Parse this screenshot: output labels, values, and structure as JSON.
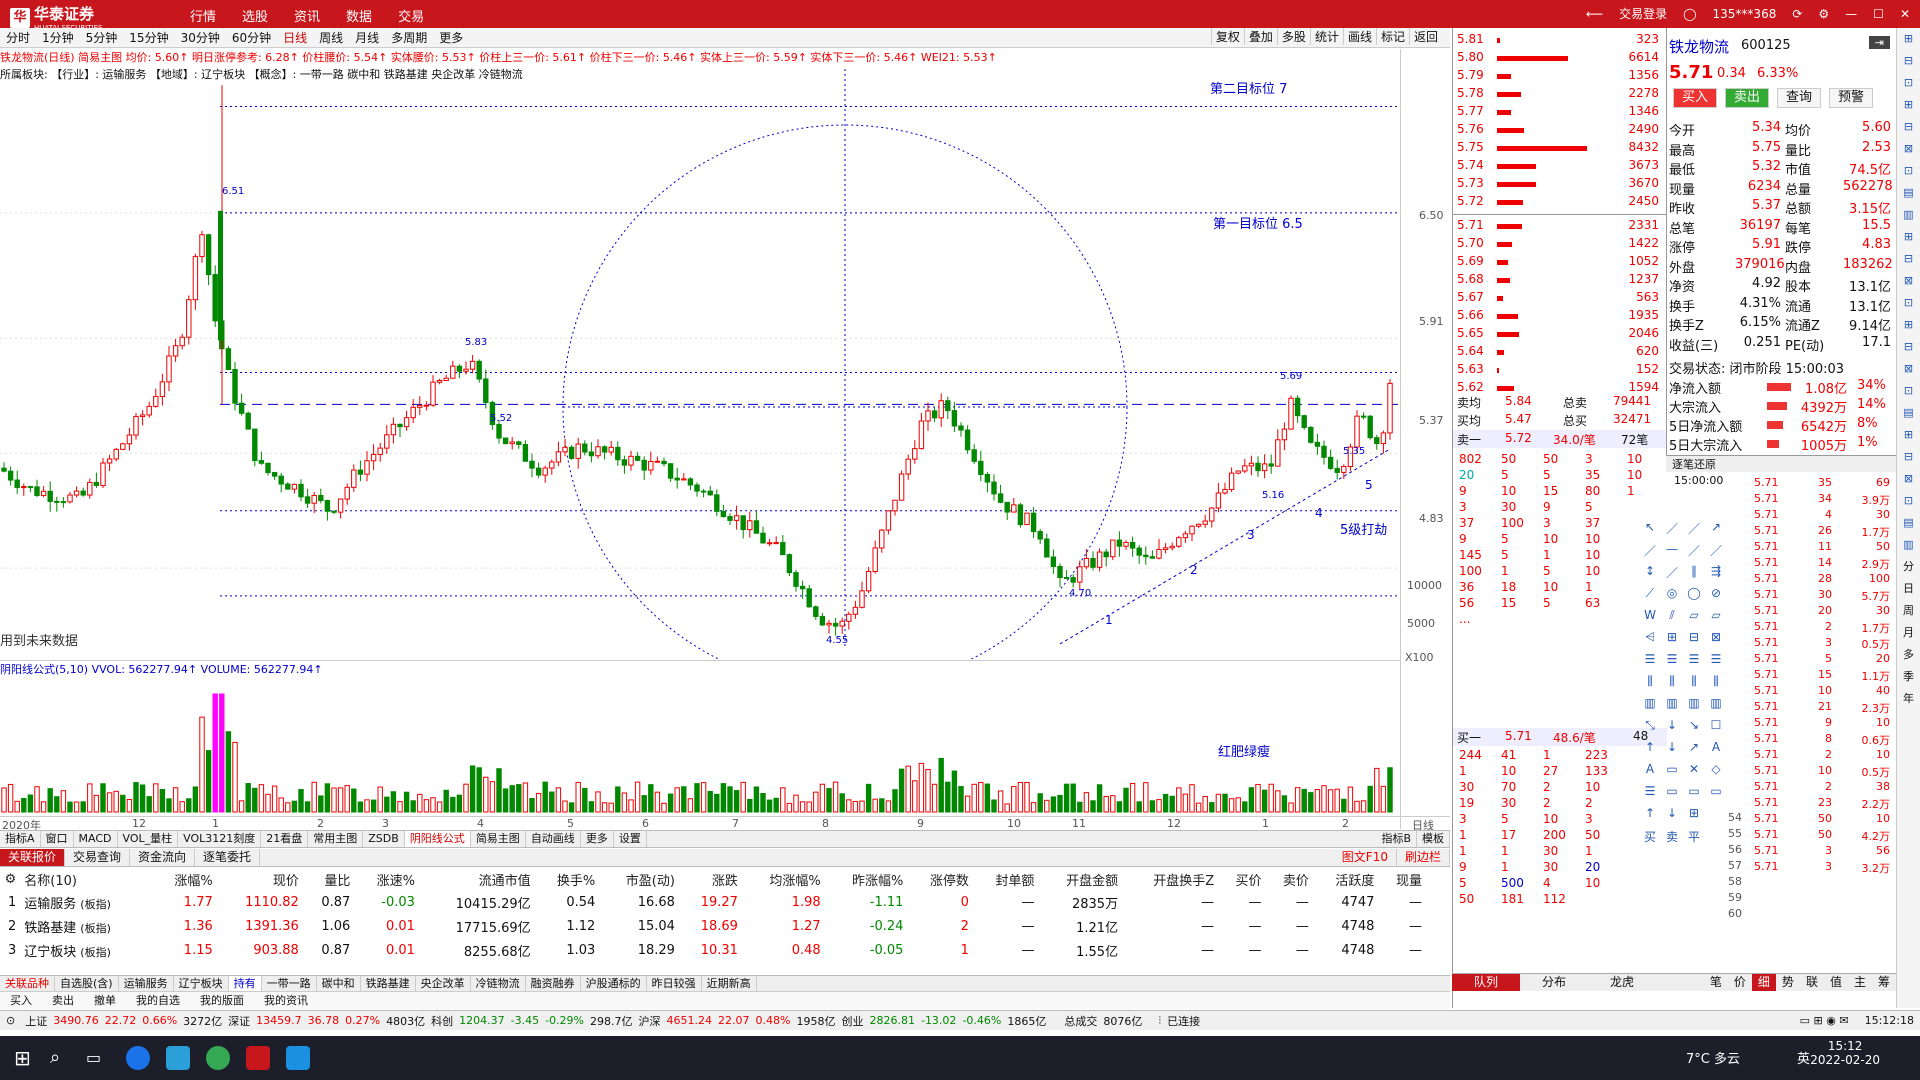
{
  "app": {
    "brand": "华泰证券",
    "brand_en": "HUATAI SECURITIES",
    "menu": [
      "行情",
      "选股",
      "资讯",
      "数据",
      "交易"
    ],
    "login": "交易登录",
    "user": "135***368"
  },
  "periods": [
    "分时",
    "1分钟",
    "5分钟",
    "15分钟",
    "30分钟",
    "60分钟",
    "日线",
    "周线",
    "月线",
    "多周期",
    "更多"
  ],
  "active_period": "日线",
  "chart_tools": [
    "复权",
    "叠加",
    "多股",
    "统计",
    "画线",
    "标记",
    "返回"
  ],
  "main_info": "铁龙物流(日线) 简易主图 均价: 5.60↑ 明日涨停参考: 6.28↑ 价柱腰价: 5.54↑ 实体腰价: 5.53↑ 价柱上三一价: 5.61↑ 价柱下三一价: 5.46↑ 实体上三一价: 5.59↑ 实体下三一价: 5.46↑ WEI21: 5.53↑",
  "sector_line": "所属板块: 【行业】: 运输服务 【地域】: 辽宁板块 【概念】: 一带一路 碳中和 铁路基建 央企改革 冷链物流",
  "annotations": {
    "target2": "第二目标位 7",
    "target1": "第一目标位 6.5",
    "wave5": "5级打劫",
    "future_data": "用到未来数据",
    "vol_note": "红肥绿瘦"
  },
  "price_labels": [
    "6.51",
    "5.83",
    "5.52",
    "5.69",
    "5.35",
    "5.16",
    "4.70",
    "4.55"
  ],
  "wave_labels": [
    "1",
    "2",
    "3",
    "4",
    "5"
  ],
  "y_ticks": [
    "6.50",
    "5.91",
    "5.37",
    "4.83"
  ],
  "vol_ticks": [
    "10000",
    "5000"
  ],
  "vol_unit": "X100",
  "vol_header": "阴阳线公式(5,10) VVOL: 562277.94↑ VOLUME: 562277.94↑",
  "x_ticks": [
    "2020年",
    "12",
    "1",
    "2",
    "3",
    "4",
    "5",
    "6",
    "7",
    "8",
    "9",
    "10",
    "11",
    "12",
    "1",
    "2"
  ],
  "x_right": "日线",
  "indicator_tabs": [
    "指标A",
    "窗口",
    "MACD",
    "VOL_量柱",
    "VOL3121刻度",
    "21看盘",
    "常用主图",
    "ZSDB",
    "阴阳线公式",
    "简易主图",
    "自动画线",
    "更多",
    "设置"
  ],
  "indicator_active": "阴阳线公式",
  "indicator_right": [
    "指标B",
    "模板"
  ],
  "bottom_tabs": [
    "关联报价",
    "交易查询",
    "资金流向",
    "逐笔委托"
  ],
  "bottom_tabs_right": [
    "图文F10",
    "刷边栏"
  ],
  "table": {
    "headers": [
      "名称(10)",
      "涨幅%",
      "现价",
      "量比",
      "涨速%",
      "流通市值",
      "换手%",
      "市盈(动)",
      "涨跌",
      "均涨幅%",
      "昨涨幅%",
      "涨停数",
      "封单额",
      "开盘金额",
      "开盘换手Z",
      "买价",
      "卖价",
      "活跃度",
      "现量"
    ],
    "rows": [
      [
        "1",
        "运输服务",
        "(板指)",
        "1.77",
        "1110.82",
        "0.87",
        "-0.03",
        "10415.29亿",
        "0.54",
        "16.68",
        "19.27",
        "1.98",
        "-1.11",
        "0",
        "—",
        "2835万",
        "—",
        "—",
        "—",
        "4747",
        "—"
      ],
      [
        "2",
        "铁路基建",
        "(板指)",
        "1.36",
        "1391.36",
        "1.06",
        "0.01",
        "17715.69亿",
        "1.12",
        "15.04",
        "18.69",
        "1.27",
        "-0.24",
        "2",
        "—",
        "1.21亿",
        "—",
        "—",
        "—",
        "4748",
        "—"
      ],
      [
        "3",
        "辽宁板块",
        "(板指)",
        "1.15",
        "903.88",
        "0.87",
        "0.01",
        "8255.68亿",
        "1.03",
        "18.29",
        "10.31",
        "0.48",
        "-0.05",
        "1",
        "—",
        "1.55亿",
        "—",
        "—",
        "—",
        "4748",
        "—"
      ]
    ]
  },
  "sheet_tabs": [
    "关联品种",
    "自选股(含)",
    "运输服务",
    "辽宁板块",
    "持有",
    "一带一路",
    "碳中和",
    "铁路基建",
    "央企改革",
    "冷链物流",
    "融资融券",
    "沪股通标的",
    "昨日较强",
    "近期新高"
  ],
  "sheet_active": "持有",
  "trade_bar": [
    "买入",
    "卖出",
    "撤单",
    "我的自选",
    "我的版面",
    "我的资讯"
  ],
  "status": {
    "sh_name": "上证",
    "sh": "3490.76",
    "sh_chg": "22.72",
    "sh_pct": "0.66%",
    "sh_amt": "3272亿",
    "sz_name": "深证",
    "sz": "13459.7",
    "sz_chg": "36.78",
    "sz_pct": "0.27%",
    "sz_amt": "4803亿",
    "kc_name": "科创",
    "kc": "1204.37",
    "kc_chg": "-3.45",
    "kc_pct": "-0.29%",
    "kc_amt": "298.7亿",
    "hs_name": "沪深",
    "hs": "4651.24",
    "hs_chg": "22.07",
    "hs_pct": "0.48%",
    "hs_amt": "1958亿",
    "cy_name": "创业",
    "cy": "2826.81",
    "cy_chg": "-13.02",
    "cy_pct": "-0.46%",
    "cy_amt": "1865亿",
    "total_label": "总成交",
    "total": "8076亿",
    "conn": "已连接",
    "time": "15:12:18"
  },
  "taskbar": {
    "weather": "7°C 多云",
    "lang": "英",
    "time": "15:12",
    "date": "2022-02-20"
  },
  "asks": [
    [
      "5.81",
      "323"
    ],
    [
      "5.80",
      "6614"
    ],
    [
      "5.79",
      "1356"
    ],
    [
      "5.78",
      "2278"
    ],
    [
      "5.77",
      "1346"
    ],
    [
      "5.76",
      "2490"
    ],
    [
      "5.75",
      "8432"
    ],
    [
      "5.74",
      "3673"
    ],
    [
      "5.73",
      "3670"
    ],
    [
      "5.72",
      "2450"
    ]
  ],
  "bids": [
    [
      "5.71",
      "2331"
    ],
    [
      "5.70",
      "1422"
    ],
    [
      "5.69",
      "1052"
    ],
    [
      "5.68",
      "1237"
    ],
    [
      "5.67",
      "563"
    ],
    [
      "5.66",
      "1935"
    ],
    [
      "5.65",
      "2046"
    ],
    [
      "5.64",
      "620"
    ],
    [
      "5.63",
      "152"
    ],
    [
      "5.62",
      "1594"
    ]
  ],
  "avg": {
    "sell_label": "卖均",
    "sell": "5.84",
    "sell_total_label": "总卖",
    "sell_total": "79441",
    "buy_label": "买均",
    "buy": "5.47",
    "buy_total_label": "总买",
    "buy_total": "32471"
  },
  "sell1": {
    "label": "卖一",
    "price": "5.72",
    "qty": "34.0/笔",
    "count": "72笔"
  },
  "buy1": {
    "label": "买一",
    "price": "5.71",
    "qty": "48.6/笔",
    "count": "48"
  },
  "sell_queue": [
    [
      "802",
      "50",
      "50",
      "3",
      "10"
    ],
    [
      "20",
      "5",
      "5",
      "35",
      "10"
    ],
    [
      "9",
      "10",
      "15",
      "80",
      "1"
    ],
    [
      "3",
      "30",
      "9",
      "5",
      ""
    ],
    [
      "37",
      "100",
      "3",
      "37",
      ""
    ],
    [
      "9",
      "5",
      "10",
      "10",
      ""
    ],
    [
      "145",
      "5",
      "1",
      "10",
      ""
    ],
    [
      "100",
      "1",
      "5",
      "10",
      ""
    ],
    [
      "36",
      "18",
      "10",
      "1",
      ""
    ],
    [
      "56",
      "15",
      "5",
      "63",
      ""
    ],
    [
      "...",
      "",
      "",
      "",
      ""
    ]
  ],
  "buy_queue": [
    [
      "244",
      "41",
      "1",
      "223"
    ],
    [
      "1",
      "10",
      "27",
      "133"
    ],
    [
      "30",
      "70",
      "2",
      "10"
    ],
    [
      "19",
      "30",
      "2",
      "2"
    ],
    [
      "3",
      "5",
      "10",
      "3"
    ],
    [
      "1",
      "17",
      "200",
      "50"
    ],
    [
      "1",
      "1",
      "30",
      "1"
    ],
    [
      "9",
      "1",
      "30",
      "20"
    ],
    [
      "5",
      "500",
      "4",
      "10"
    ],
    [
      "50",
      "181",
      "112",
      ""
    ]
  ],
  "stock": {
    "name": "铁龙物流",
    "code": "600125",
    "price": "5.71",
    "chg": "0.34",
    "pct": "6.33%",
    "buttons": [
      "买入",
      "卖出",
      "查询",
      "预警"
    ]
  },
  "quote_rows": [
    [
      "今开",
      "5.34",
      "均价",
      "5.60"
    ],
    [
      "最高",
      "5.75",
      "量比",
      "2.53"
    ],
    [
      "最低",
      "5.32",
      "市值",
      "74.5亿"
    ],
    [
      "现量",
      "6234",
      "总量",
      "562278"
    ],
    [
      "昨收",
      "5.37",
      "总额",
      "3.15亿"
    ],
    [
      "总笔",
      "36197",
      "每笔",
      "15.5"
    ],
    [
      "涨停",
      "5.91",
      "跌停",
      "4.83"
    ],
    [
      "外盘",
      "379016",
      "内盘",
      "183262"
    ],
    [
      "净资",
      "4.92",
      "股本",
      "13.1亿"
    ],
    [
      "换手",
      "4.31%",
      "流通",
      "13.1亿"
    ],
    [
      "换手Z",
      "6.15%",
      "流通Z",
      "9.14亿"
    ],
    [
      "收益(三)",
      "0.251",
      "PE(动)",
      "17.1"
    ]
  ],
  "trade_state": "交易状态: 闭市阶段 15:00:03",
  "flows": [
    [
      "净流入额",
      "1.08亿",
      "34%"
    ],
    [
      "大宗流入",
      "4392万",
      "14%"
    ],
    [
      "5日净流入额",
      "6542万",
      "8%"
    ],
    [
      "5日大宗流入",
      "1005万",
      "1%"
    ]
  ],
  "tick_title": "逐笔还原",
  "tick_time": "15:00:00",
  "ticks": [
    [
      "5.71",
      "35",
      "69"
    ],
    [
      "5.71",
      "34",
      "3.9万"
    ],
    [
      "5.71",
      "4",
      "30"
    ],
    [
      "5.71",
      "26",
      "1.7万"
    ],
    [
      "5.71",
      "11",
      "50"
    ],
    [
      "5.71",
      "14",
      "2.9万"
    ],
    [
      "5.71",
      "28",
      "100"
    ],
    [
      "5.71",
      "30",
      "5.7万"
    ],
    [
      "5.71",
      "20",
      "30"
    ],
    [
      "5.71",
      "2",
      "1.7万"
    ],
    [
      "5.71",
      "3",
      "0.5万"
    ],
    [
      "5.71",
      "5",
      "20"
    ],
    [
      "5.71",
      "15",
      "1.1万"
    ],
    [
      "5.71",
      "10",
      "40"
    ],
    [
      "5.71",
      "21",
      "2.3万"
    ],
    [
      "5.71",
      "9",
      "10"
    ],
    [
      "5.71",
      "8",
      "0.6万"
    ],
    [
      "5.71",
      "2",
      "10"
    ],
    [
      "5.71",
      "10",
      "0.5万"
    ],
    [
      "5.71",
      "2",
      "38"
    ],
    [
      "5.71",
      "23",
      "2.2万"
    ],
    [
      "5.71",
      "50",
      "10"
    ],
    [
      "5.71",
      "50",
      "4.2万"
    ],
    [
      "5.71",
      "3",
      "56"
    ],
    [
      "5.71",
      "3",
      "3.2万"
    ]
  ],
  "tick_idx": [
    "54",
    "55",
    "56",
    "57",
    "58",
    "59",
    "60"
  ],
  "right_bottom_tabs": [
    "队列",
    "分布",
    "龙虎"
  ],
  "right_bottom_tabs2": [
    "笔",
    "价",
    "细",
    "势",
    "联",
    "值",
    "主",
    "筹"
  ],
  "rtools": [
    "分",
    "日",
    "周",
    "月",
    "多",
    "季",
    "年"
  ]
}
